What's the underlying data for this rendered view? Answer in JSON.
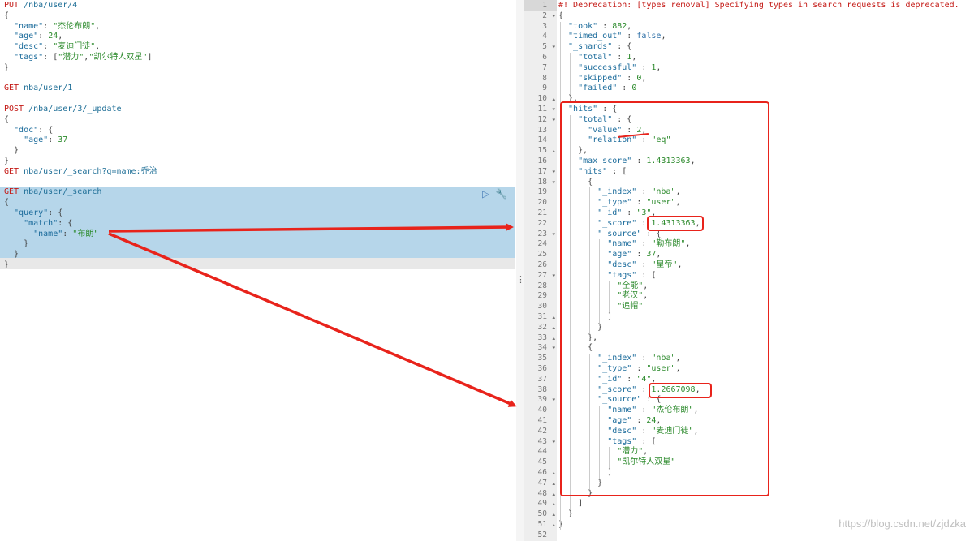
{
  "request_lines": [
    [
      {
        "t": "PUT",
        "c": "method"
      },
      {
        "t": " /nba/user/4",
        "c": "url"
      }
    ],
    [
      {
        "t": "{",
        "c": "punc"
      }
    ],
    [
      {
        "t": "  \"name\"",
        "c": "key"
      },
      {
        "t": ": ",
        "c": "punc"
      },
      {
        "t": "\"杰伦布朗\"",
        "c": "str"
      },
      {
        "t": ",",
        "c": "punc"
      }
    ],
    [
      {
        "t": "  \"age\"",
        "c": "key"
      },
      {
        "t": ": ",
        "c": "punc"
      },
      {
        "t": "24",
        "c": "num"
      },
      {
        "t": ",",
        "c": "punc"
      }
    ],
    [
      {
        "t": "  \"desc\"",
        "c": "key"
      },
      {
        "t": ": ",
        "c": "punc"
      },
      {
        "t": "\"麦迪门徒\"",
        "c": "str"
      },
      {
        "t": ",",
        "c": "punc"
      }
    ],
    [
      {
        "t": "  \"tags\"",
        "c": "key"
      },
      {
        "t": ": [",
        "c": "punc"
      },
      {
        "t": "\"潜力\"",
        "c": "str"
      },
      {
        "t": ",",
        "c": "punc"
      },
      {
        "t": "\"凯尔特人双星\"",
        "c": "str"
      },
      {
        "t": "]",
        "c": "punc"
      }
    ],
    [
      {
        "t": "}",
        "c": "punc"
      }
    ],
    [],
    [
      {
        "t": "GET",
        "c": "method"
      },
      {
        "t": " nba/user/1",
        "c": "url"
      }
    ],
    [],
    [
      {
        "t": "POST",
        "c": "method"
      },
      {
        "t": " /nba/user/3/_update",
        "c": "url"
      }
    ],
    [
      {
        "t": "{",
        "c": "punc"
      }
    ],
    [
      {
        "t": "  \"doc\"",
        "c": "key"
      },
      {
        "t": ": {",
        "c": "punc"
      }
    ],
    [
      {
        "t": "    \"age\"",
        "c": "key"
      },
      {
        "t": ": ",
        "c": "punc"
      },
      {
        "t": "37",
        "c": "num"
      }
    ],
    [
      {
        "t": "  }",
        "c": "punc"
      }
    ],
    [
      {
        "t": "}",
        "c": "punc"
      }
    ],
    [
      {
        "t": "GET",
        "c": "method"
      },
      {
        "t": " nba/user/_search?q=name:乔治",
        "c": "url"
      }
    ],
    [],
    [
      {
        "t": "GET",
        "c": "method"
      },
      {
        "t": " nba/user/_search",
        "c": "url"
      }
    ],
    [
      {
        "t": "{",
        "c": "punc"
      }
    ],
    [
      {
        "t": "  \"query\"",
        "c": "key"
      },
      {
        "t": ": {",
        "c": "punc"
      }
    ],
    [
      {
        "t": "    \"match\"",
        "c": "key"
      },
      {
        "t": ": {",
        "c": "punc"
      }
    ],
    [
      {
        "t": "      \"name\"",
        "c": "key"
      },
      {
        "t": ": ",
        "c": "punc"
      },
      {
        "t": "\"布朗\"",
        "c": "str"
      }
    ],
    [
      {
        "t": "    }",
        "c": "punc"
      }
    ],
    [
      {
        "t": "  }",
        "c": "punc"
      }
    ],
    [
      {
        "t": "}",
        "c": "punc"
      }
    ]
  ],
  "response_lines": [
    {
      "n": "1",
      "f": "",
      "parts": [
        {
          "t": "#! Deprecation: [types removal] Specifying types in search requests is deprecated.",
          "c": "deprecation"
        }
      ]
    },
    {
      "n": "2",
      "f": "▾",
      "parts": [
        {
          "t": "{",
          "c": "punc"
        }
      ]
    },
    {
      "n": "3",
      "f": "",
      "parts": [
        {
          "t": "  \"took\"",
          "c": "res-key"
        },
        {
          "t": " : ",
          "c": "punc"
        },
        {
          "t": "882",
          "c": "res-num"
        },
        {
          "t": ",",
          "c": "punc"
        }
      ]
    },
    {
      "n": "4",
      "f": "",
      "parts": [
        {
          "t": "  \"timed_out\"",
          "c": "res-key"
        },
        {
          "t": " : ",
          "c": "punc"
        },
        {
          "t": "false",
          "c": "res-bool"
        },
        {
          "t": ",",
          "c": "punc"
        }
      ]
    },
    {
      "n": "5",
      "f": "▾",
      "parts": [
        {
          "t": "  \"_shards\"",
          "c": "res-key"
        },
        {
          "t": " : {",
          "c": "punc"
        }
      ]
    },
    {
      "n": "6",
      "f": "",
      "parts": [
        {
          "t": "    \"total\"",
          "c": "res-key"
        },
        {
          "t": " : ",
          "c": "punc"
        },
        {
          "t": "1",
          "c": "res-num"
        },
        {
          "t": ",",
          "c": "punc"
        }
      ]
    },
    {
      "n": "7",
      "f": "",
      "parts": [
        {
          "t": "    \"successful\"",
          "c": "res-key"
        },
        {
          "t": " : ",
          "c": "punc"
        },
        {
          "t": "1",
          "c": "res-num"
        },
        {
          "t": ",",
          "c": "punc"
        }
      ]
    },
    {
      "n": "8",
      "f": "",
      "parts": [
        {
          "t": "    \"skipped\"",
          "c": "res-key"
        },
        {
          "t": " : ",
          "c": "punc"
        },
        {
          "t": "0",
          "c": "res-num"
        },
        {
          "t": ",",
          "c": "punc"
        }
      ]
    },
    {
      "n": "9",
      "f": "",
      "parts": [
        {
          "t": "    \"failed\"",
          "c": "res-key"
        },
        {
          "t": " : ",
          "c": "punc"
        },
        {
          "t": "0",
          "c": "res-num"
        }
      ]
    },
    {
      "n": "10",
      "f": "▴",
      "parts": [
        {
          "t": "  },",
          "c": "punc"
        }
      ]
    },
    {
      "n": "11",
      "f": "▾",
      "parts": [
        {
          "t": "  \"hits\"",
          "c": "res-key"
        },
        {
          "t": " : {",
          "c": "punc"
        }
      ]
    },
    {
      "n": "12",
      "f": "▾",
      "parts": [
        {
          "t": "    \"total\"",
          "c": "res-key"
        },
        {
          "t": " : {",
          "c": "punc"
        }
      ]
    },
    {
      "n": "13",
      "f": "",
      "parts": [
        {
          "t": "      \"value\"",
          "c": "res-key"
        },
        {
          "t": " : ",
          "c": "punc"
        },
        {
          "t": "2",
          "c": "res-num"
        },
        {
          "t": ",",
          "c": "punc"
        }
      ]
    },
    {
      "n": "14",
      "f": "",
      "parts": [
        {
          "t": "      \"relation\"",
          "c": "res-key"
        },
        {
          "t": " : ",
          "c": "punc"
        },
        {
          "t": "\"eq\"",
          "c": "res-str"
        }
      ]
    },
    {
      "n": "15",
      "f": "▴",
      "parts": [
        {
          "t": "    },",
          "c": "punc"
        }
      ]
    },
    {
      "n": "16",
      "f": "",
      "parts": [
        {
          "t": "    \"max_score\"",
          "c": "res-key"
        },
        {
          "t": " : ",
          "c": "punc"
        },
        {
          "t": "1.4313363",
          "c": "res-num"
        },
        {
          "t": ",",
          "c": "punc"
        }
      ]
    },
    {
      "n": "17",
      "f": "▾",
      "parts": [
        {
          "t": "    \"hits\"",
          "c": "res-key"
        },
        {
          "t": " : [",
          "c": "punc"
        }
      ]
    },
    {
      "n": "18",
      "f": "▾",
      "parts": [
        {
          "t": "      {",
          "c": "punc"
        }
      ]
    },
    {
      "n": "19",
      "f": "",
      "parts": [
        {
          "t": "        \"_index\"",
          "c": "res-key"
        },
        {
          "t": " : ",
          "c": "punc"
        },
        {
          "t": "\"nba\"",
          "c": "res-str"
        },
        {
          "t": ",",
          "c": "punc"
        }
      ]
    },
    {
      "n": "20",
      "f": "",
      "parts": [
        {
          "t": "        \"_type\"",
          "c": "res-key"
        },
        {
          "t": " : ",
          "c": "punc"
        },
        {
          "t": "\"user\"",
          "c": "res-str"
        },
        {
          "t": ",",
          "c": "punc"
        }
      ]
    },
    {
      "n": "21",
      "f": "",
      "parts": [
        {
          "t": "        \"_id\"",
          "c": "res-key"
        },
        {
          "t": " : ",
          "c": "punc"
        },
        {
          "t": "\"3\"",
          "c": "res-str"
        },
        {
          "t": ",",
          "c": "punc"
        }
      ]
    },
    {
      "n": "22",
      "f": "",
      "parts": [
        {
          "t": "        \"_score\"",
          "c": "res-key"
        },
        {
          "t": " : ",
          "c": "punc"
        },
        {
          "t": "1.4313363",
          "c": "res-num"
        },
        {
          "t": ",",
          "c": "punc"
        }
      ]
    },
    {
      "n": "23",
      "f": "▾",
      "parts": [
        {
          "t": "        \"_source\"",
          "c": "res-key"
        },
        {
          "t": " : {",
          "c": "punc"
        }
      ]
    },
    {
      "n": "24",
      "f": "",
      "parts": [
        {
          "t": "          \"name\"",
          "c": "res-key"
        },
        {
          "t": " : ",
          "c": "punc"
        },
        {
          "t": "\"勒布朗\"",
          "c": "res-str"
        },
        {
          "t": ",",
          "c": "punc"
        }
      ]
    },
    {
      "n": "25",
      "f": "",
      "parts": [
        {
          "t": "          \"age\"",
          "c": "res-key"
        },
        {
          "t": " : ",
          "c": "punc"
        },
        {
          "t": "37",
          "c": "res-num"
        },
        {
          "t": ",",
          "c": "punc"
        }
      ]
    },
    {
      "n": "26",
      "f": "",
      "parts": [
        {
          "t": "          \"desc\"",
          "c": "res-key"
        },
        {
          "t": " : ",
          "c": "punc"
        },
        {
          "t": "\"皇帝\"",
          "c": "res-str"
        },
        {
          "t": ",",
          "c": "punc"
        }
      ]
    },
    {
      "n": "27",
      "f": "▾",
      "parts": [
        {
          "t": "          \"tags\"",
          "c": "res-key"
        },
        {
          "t": " : [",
          "c": "punc"
        }
      ]
    },
    {
      "n": "28",
      "f": "",
      "parts": [
        {
          "t": "            \"全能\"",
          "c": "res-str"
        },
        {
          "t": ",",
          "c": "punc"
        }
      ]
    },
    {
      "n": "29",
      "f": "",
      "parts": [
        {
          "t": "            \"老汉\"",
          "c": "res-str"
        },
        {
          "t": ",",
          "c": "punc"
        }
      ]
    },
    {
      "n": "30",
      "f": "",
      "parts": [
        {
          "t": "            \"追帽\"",
          "c": "res-str"
        }
      ]
    },
    {
      "n": "31",
      "f": "▴",
      "parts": [
        {
          "t": "          ]",
          "c": "punc"
        }
      ]
    },
    {
      "n": "32",
      "f": "▴",
      "parts": [
        {
          "t": "        }",
          "c": "punc"
        }
      ]
    },
    {
      "n": "33",
      "f": "▴",
      "parts": [
        {
          "t": "      },",
          "c": "punc"
        }
      ]
    },
    {
      "n": "34",
      "f": "▾",
      "parts": [
        {
          "t": "      {",
          "c": "punc"
        }
      ]
    },
    {
      "n": "35",
      "f": "",
      "parts": [
        {
          "t": "        \"_index\"",
          "c": "res-key"
        },
        {
          "t": " : ",
          "c": "punc"
        },
        {
          "t": "\"nba\"",
          "c": "res-str"
        },
        {
          "t": ",",
          "c": "punc"
        }
      ]
    },
    {
      "n": "36",
      "f": "",
      "parts": [
        {
          "t": "        \"_type\"",
          "c": "res-key"
        },
        {
          "t": " : ",
          "c": "punc"
        },
        {
          "t": "\"user\"",
          "c": "res-str"
        },
        {
          "t": ",",
          "c": "punc"
        }
      ]
    },
    {
      "n": "37",
      "f": "",
      "parts": [
        {
          "t": "        \"_id\"",
          "c": "res-key"
        },
        {
          "t": " : ",
          "c": "punc"
        },
        {
          "t": "\"4\"",
          "c": "res-str"
        },
        {
          "t": ",",
          "c": "punc"
        }
      ]
    },
    {
      "n": "38",
      "f": "",
      "parts": [
        {
          "t": "        \"_score\"",
          "c": "res-key"
        },
        {
          "t": " : ",
          "c": "punc"
        },
        {
          "t": "1.2667098",
          "c": "res-num"
        },
        {
          "t": ",",
          "c": "punc"
        }
      ]
    },
    {
      "n": "39",
      "f": "▾",
      "parts": [
        {
          "t": "        \"_source\"",
          "c": "res-key"
        },
        {
          "t": " : {",
          "c": "punc"
        }
      ]
    },
    {
      "n": "40",
      "f": "",
      "parts": [
        {
          "t": "          \"name\"",
          "c": "res-key"
        },
        {
          "t": " : ",
          "c": "punc"
        },
        {
          "t": "\"杰伦布朗\"",
          "c": "res-str"
        },
        {
          "t": ",",
          "c": "punc"
        }
      ]
    },
    {
      "n": "41",
      "f": "",
      "parts": [
        {
          "t": "          \"age\"",
          "c": "res-key"
        },
        {
          "t": " : ",
          "c": "punc"
        },
        {
          "t": "24",
          "c": "res-num"
        },
        {
          "t": ",",
          "c": "punc"
        }
      ]
    },
    {
      "n": "42",
      "f": "",
      "parts": [
        {
          "t": "          \"desc\"",
          "c": "res-key"
        },
        {
          "t": " : ",
          "c": "punc"
        },
        {
          "t": "\"麦迪门徒\"",
          "c": "res-str"
        },
        {
          "t": ",",
          "c": "punc"
        }
      ]
    },
    {
      "n": "43",
      "f": "▾",
      "parts": [
        {
          "t": "          \"tags\"",
          "c": "res-key"
        },
        {
          "t": " : [",
          "c": "punc"
        }
      ]
    },
    {
      "n": "44",
      "f": "",
      "parts": [
        {
          "t": "            \"潜力\"",
          "c": "res-str"
        },
        {
          "t": ",",
          "c": "punc"
        }
      ]
    },
    {
      "n": "45",
      "f": "",
      "parts": [
        {
          "t": "            \"凯尔特人双星\"",
          "c": "res-str"
        }
      ]
    },
    {
      "n": "46",
      "f": "▴",
      "parts": [
        {
          "t": "          ]",
          "c": "punc"
        }
      ]
    },
    {
      "n": "47",
      "f": "▴",
      "parts": [
        {
          "t": "        }",
          "c": "punc"
        }
      ]
    },
    {
      "n": "48",
      "f": "▴",
      "parts": [
        {
          "t": "      }",
          "c": "punc"
        }
      ]
    },
    {
      "n": "49",
      "f": "▴",
      "parts": [
        {
          "t": "    ]",
          "c": "punc"
        }
      ]
    },
    {
      "n": "50",
      "f": "▴",
      "parts": [
        {
          "t": "  }",
          "c": "punc"
        }
      ]
    },
    {
      "n": "51",
      "f": "▴",
      "parts": [
        {
          "t": "}",
          "c": "punc"
        }
      ]
    },
    {
      "n": "52",
      "f": "",
      "parts": []
    }
  ],
  "icons": {
    "run": "play-icon",
    "settings": "wrench-icon",
    "resize": "vertical-dots-icon"
  },
  "watermark": "https://blog.csdn.net/zjdzka",
  "colors": {
    "annotation": "#e8231b",
    "selection": "#b6d6ea",
    "method": "#c41a16",
    "string": "#2c8a2c",
    "key": "#1b6b9b"
  }
}
